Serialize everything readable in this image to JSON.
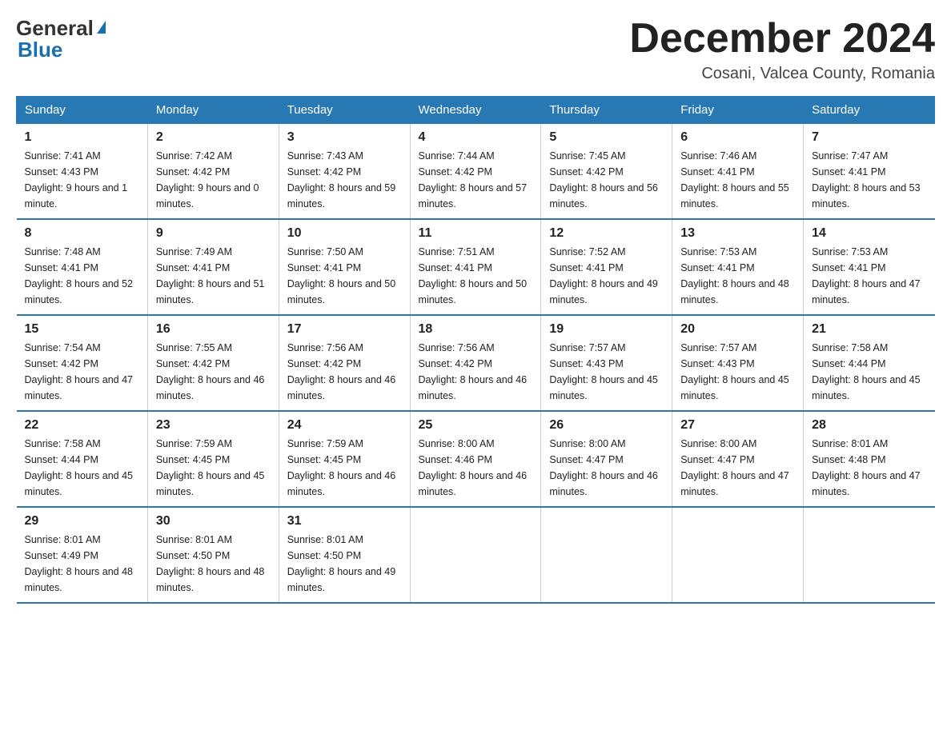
{
  "header": {
    "logo_general": "General",
    "logo_blue": "Blue",
    "month_title": "December 2024",
    "location": "Cosani, Valcea County, Romania"
  },
  "weekdays": [
    "Sunday",
    "Monday",
    "Tuesday",
    "Wednesday",
    "Thursday",
    "Friday",
    "Saturday"
  ],
  "weeks": [
    [
      {
        "day": "1",
        "sunrise": "7:41 AM",
        "sunset": "4:43 PM",
        "daylight": "9 hours and 1 minute."
      },
      {
        "day": "2",
        "sunrise": "7:42 AM",
        "sunset": "4:42 PM",
        "daylight": "9 hours and 0 minutes."
      },
      {
        "day": "3",
        "sunrise": "7:43 AM",
        "sunset": "4:42 PM",
        "daylight": "8 hours and 59 minutes."
      },
      {
        "day": "4",
        "sunrise": "7:44 AM",
        "sunset": "4:42 PM",
        "daylight": "8 hours and 57 minutes."
      },
      {
        "day": "5",
        "sunrise": "7:45 AM",
        "sunset": "4:42 PM",
        "daylight": "8 hours and 56 minutes."
      },
      {
        "day": "6",
        "sunrise": "7:46 AM",
        "sunset": "4:41 PM",
        "daylight": "8 hours and 55 minutes."
      },
      {
        "day": "7",
        "sunrise": "7:47 AM",
        "sunset": "4:41 PM",
        "daylight": "8 hours and 53 minutes."
      }
    ],
    [
      {
        "day": "8",
        "sunrise": "7:48 AM",
        "sunset": "4:41 PM",
        "daylight": "8 hours and 52 minutes."
      },
      {
        "day": "9",
        "sunrise": "7:49 AM",
        "sunset": "4:41 PM",
        "daylight": "8 hours and 51 minutes."
      },
      {
        "day": "10",
        "sunrise": "7:50 AM",
        "sunset": "4:41 PM",
        "daylight": "8 hours and 50 minutes."
      },
      {
        "day": "11",
        "sunrise": "7:51 AM",
        "sunset": "4:41 PM",
        "daylight": "8 hours and 50 minutes."
      },
      {
        "day": "12",
        "sunrise": "7:52 AM",
        "sunset": "4:41 PM",
        "daylight": "8 hours and 49 minutes."
      },
      {
        "day": "13",
        "sunrise": "7:53 AM",
        "sunset": "4:41 PM",
        "daylight": "8 hours and 48 minutes."
      },
      {
        "day": "14",
        "sunrise": "7:53 AM",
        "sunset": "4:41 PM",
        "daylight": "8 hours and 47 minutes."
      }
    ],
    [
      {
        "day": "15",
        "sunrise": "7:54 AM",
        "sunset": "4:42 PM",
        "daylight": "8 hours and 47 minutes."
      },
      {
        "day": "16",
        "sunrise": "7:55 AM",
        "sunset": "4:42 PM",
        "daylight": "8 hours and 46 minutes."
      },
      {
        "day": "17",
        "sunrise": "7:56 AM",
        "sunset": "4:42 PM",
        "daylight": "8 hours and 46 minutes."
      },
      {
        "day": "18",
        "sunrise": "7:56 AM",
        "sunset": "4:42 PM",
        "daylight": "8 hours and 46 minutes."
      },
      {
        "day": "19",
        "sunrise": "7:57 AM",
        "sunset": "4:43 PM",
        "daylight": "8 hours and 45 minutes."
      },
      {
        "day": "20",
        "sunrise": "7:57 AM",
        "sunset": "4:43 PM",
        "daylight": "8 hours and 45 minutes."
      },
      {
        "day": "21",
        "sunrise": "7:58 AM",
        "sunset": "4:44 PM",
        "daylight": "8 hours and 45 minutes."
      }
    ],
    [
      {
        "day": "22",
        "sunrise": "7:58 AM",
        "sunset": "4:44 PM",
        "daylight": "8 hours and 45 minutes."
      },
      {
        "day": "23",
        "sunrise": "7:59 AM",
        "sunset": "4:45 PM",
        "daylight": "8 hours and 45 minutes."
      },
      {
        "day": "24",
        "sunrise": "7:59 AM",
        "sunset": "4:45 PM",
        "daylight": "8 hours and 46 minutes."
      },
      {
        "day": "25",
        "sunrise": "8:00 AM",
        "sunset": "4:46 PM",
        "daylight": "8 hours and 46 minutes."
      },
      {
        "day": "26",
        "sunrise": "8:00 AM",
        "sunset": "4:47 PM",
        "daylight": "8 hours and 46 minutes."
      },
      {
        "day": "27",
        "sunrise": "8:00 AM",
        "sunset": "4:47 PM",
        "daylight": "8 hours and 47 minutes."
      },
      {
        "day": "28",
        "sunrise": "8:01 AM",
        "sunset": "4:48 PM",
        "daylight": "8 hours and 47 minutes."
      }
    ],
    [
      {
        "day": "29",
        "sunrise": "8:01 AM",
        "sunset": "4:49 PM",
        "daylight": "8 hours and 48 minutes."
      },
      {
        "day": "30",
        "sunrise": "8:01 AM",
        "sunset": "4:50 PM",
        "daylight": "8 hours and 48 minutes."
      },
      {
        "day": "31",
        "sunrise": "8:01 AM",
        "sunset": "4:50 PM",
        "daylight": "8 hours and 49 minutes."
      },
      null,
      null,
      null,
      null
    ]
  ]
}
